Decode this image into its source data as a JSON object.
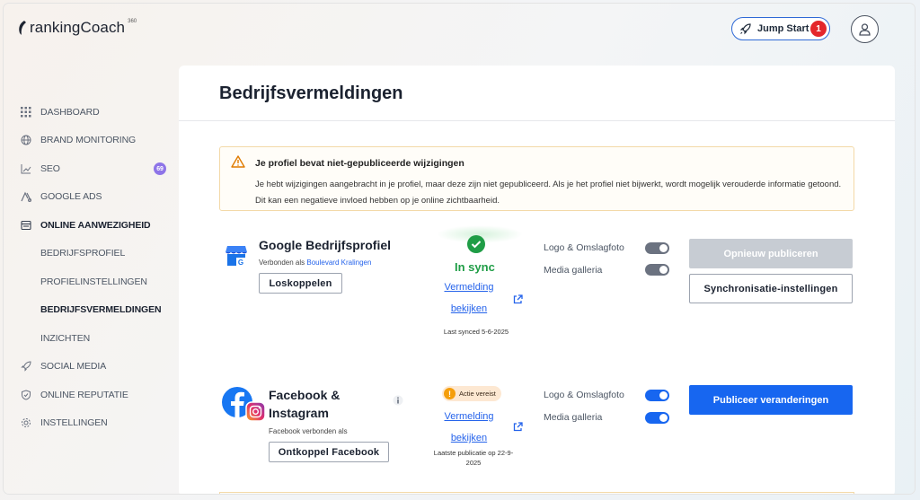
{
  "app": {
    "logo_text": "rankingCoach",
    "logo_sup": "360"
  },
  "header": {
    "jump_start_label": "Jump Start",
    "jump_start_count": "1"
  },
  "sidebar": {
    "items": [
      {
        "label": "DASHBOARD",
        "icon": "grid-icon"
      },
      {
        "label": "BRAND MONITORING",
        "icon": "globe-icon"
      },
      {
        "label": "SEO",
        "icon": "chart-icon",
        "count": "69"
      },
      {
        "label": "GOOGLE ADS",
        "icon": "ads-icon"
      },
      {
        "label": "ONLINE AANWEZIGHEID",
        "icon": "presence-icon"
      },
      {
        "label": "BEDRIJFSPROFIEL"
      },
      {
        "label": "PROFIELINSTELLINGEN"
      },
      {
        "label": "BEDRIJFSVERMELDINGEN"
      },
      {
        "label": "INZICHTEN"
      },
      {
        "label": "SOCIAL MEDIA",
        "icon": "rocket-icon"
      },
      {
        "label": "ONLINE REPUTATIE",
        "icon": "shield-icon"
      },
      {
        "label": "INSTELLINGEN",
        "icon": "gear-icon"
      }
    ]
  },
  "main": {
    "title": "Bedrijfsvermeldingen",
    "alert": {
      "title": "Je profiel bevat niet-gepubliceerde wijzigingen",
      "body": "Je hebt wijzigingen aangebracht in je profiel, maar deze zijn niet gepubliceerd. Als je het profiel niet bijwerkt, wordt mogelijk verouderde informatie getoond. Dit kan een negatieve invloed hebben op je online zichtbaarheid."
    },
    "google": {
      "name": "Google Bedrijfsprofiel",
      "connected_prefix": "Verbonden als",
      "connected_name": "Boulevard Kralingen",
      "disconnect_label": "Loskoppelen",
      "status": "In sync",
      "view_link": "Vermelding bekijken",
      "last_synced": "Last synced 5-6-2025",
      "toggle_logo": "Logo & Omslagfoto",
      "toggle_media": "Media galleria",
      "republish_label": "Opnieuw publiceren",
      "sync_settings_label": "Synchronisatie-instellingen"
    },
    "facebook": {
      "name": "Facebook & Instagram",
      "connected_text": "Facebook verbonden als",
      "disconnect_label": "Ontkoppel Facebook",
      "status": "Actie vereist",
      "view_link": "Vermelding bekijken",
      "last_published": "Laatste publicatie op 22-9-2025",
      "toggle_logo": "Logo & Omslagfoto",
      "toggle_media": "Media galleria",
      "publish_label": "Publiceer veranderingen"
    }
  },
  "colors": {
    "primary": "#1766f0",
    "success": "#1f9d46",
    "warning": "#f59e0b",
    "badge_red": "#e4262b",
    "count_purple": "#8e74e8"
  }
}
